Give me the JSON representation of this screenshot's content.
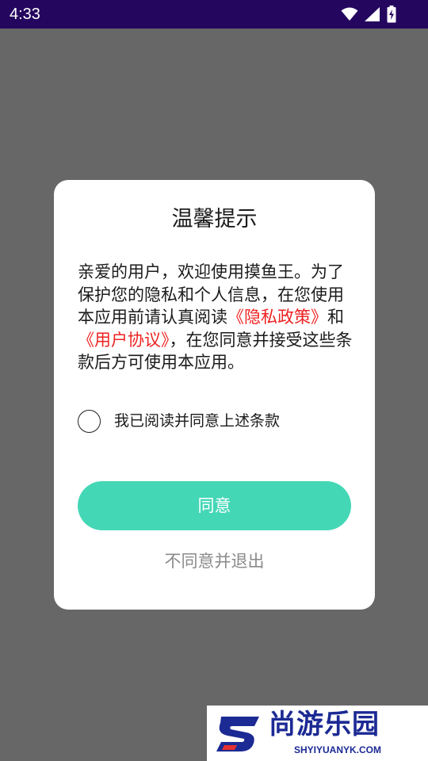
{
  "status_bar": {
    "time": "4:33",
    "icons": [
      "wifi-icon",
      "cell-signal-icon",
      "battery-charging-icon"
    ]
  },
  "dialog": {
    "title": "温馨提示",
    "message_part1": "亲爱的用户，欢迎使用摸鱼王。为了保护您的隐私和个人信息，在您使用本应用前请认真阅读",
    "privacy_link": "《隐私政策》",
    "message_and": "和",
    "agreement_link": "《用户协议》",
    "message_part2": "，在您同意并接受这些条款后方可使用本应用。",
    "consent_label": "我已阅读并同意上述条款",
    "consent_checked": false,
    "agree_button": "同意",
    "disagree_button": "不同意并退出"
  },
  "watermark": {
    "name": "尚游乐园",
    "url": "SHYIYUANYK.COM"
  },
  "colors": {
    "status_bar": "#24065f",
    "backdrop": "#676767",
    "accent": "#44d7b6",
    "link": "#ee2222",
    "watermark": "#1c2a94"
  }
}
